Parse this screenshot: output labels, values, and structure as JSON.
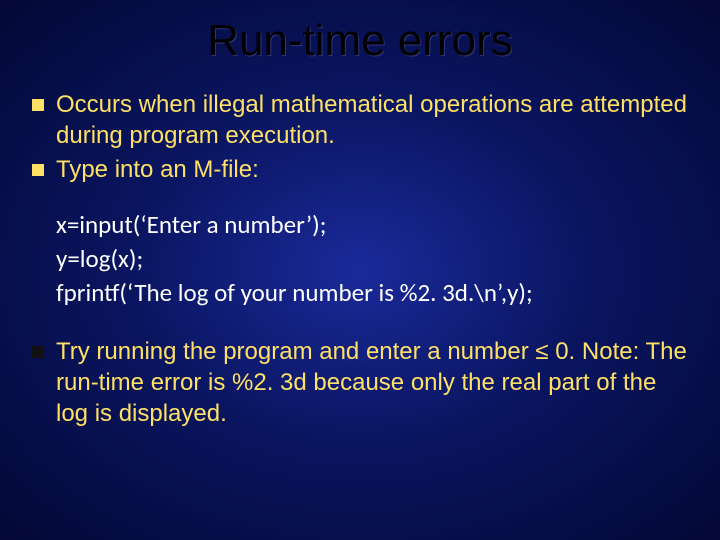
{
  "title": "Run-time errors",
  "top_bullets": [
    "Occurs when illegal mathematical operations are attempted during program execution.",
    "Type into an M-file:"
  ],
  "code_lines": [
    "x=input(‘Enter a number’);",
    "y=log(x);",
    "fprintf(‘The log of your number is %2. 3d.\\n’,y);"
  ],
  "bottom_bullets": [
    "Try running the program and enter a number ≤ 0. Note: The run-time error is %2. 3d because only the real part of the log is displayed."
  ]
}
